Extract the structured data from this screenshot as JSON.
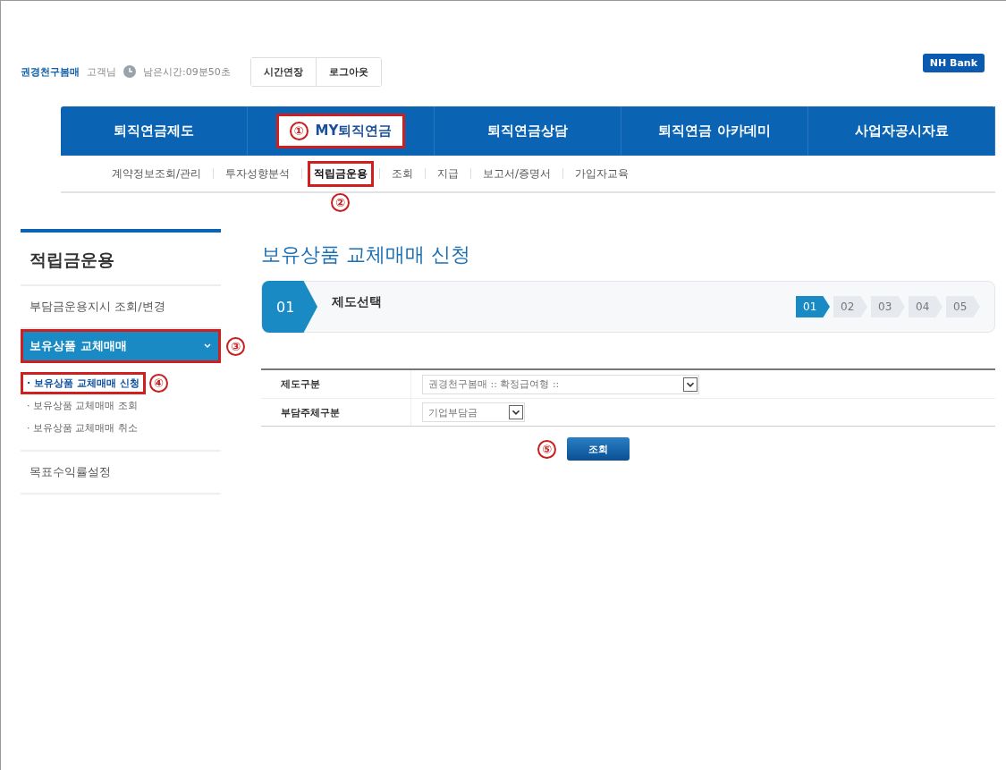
{
  "header": {
    "user_name": "권경천구봄매",
    "user_suffix": "고객님",
    "remaining_time": "남은시간:09분50초",
    "buttons": [
      "시간연장",
      "로그아웃"
    ],
    "brand": "NH Bank"
  },
  "main_nav": [
    {
      "label": "퇴직연금제도",
      "selected": false
    },
    {
      "label": "MY퇴직연금",
      "selected": true,
      "callout": "①"
    },
    {
      "label": "퇴직연금상담",
      "selected": false
    },
    {
      "label": "퇴직연금 아카데미",
      "selected": false
    },
    {
      "label": "사업자공시자료",
      "selected": false
    }
  ],
  "sub_nav": [
    {
      "label": "계약정보조회/관리",
      "selected": false
    },
    {
      "label": "투자성향분석",
      "selected": false
    },
    {
      "label": "적립금운용",
      "selected": true,
      "callout": "②"
    },
    {
      "label": "조회",
      "selected": false
    },
    {
      "label": "지급",
      "selected": false
    },
    {
      "label": "보고서/증명서",
      "selected": false
    },
    {
      "label": "가입자교육",
      "selected": false
    }
  ],
  "sidebar": {
    "title": "적립금운용",
    "items": [
      {
        "label": "부담금운용지시 조회/변경",
        "selected": false
      },
      {
        "label": "보유상품 교체매매",
        "selected": true,
        "expanded": true,
        "callout": "③",
        "children": [
          {
            "label": "· 보유상품 교체매매 신청",
            "selected": true,
            "callout": "④"
          },
          {
            "label": "· 보유상품 교체매매 조회",
            "selected": false
          },
          {
            "label": "· 보유상품 교체매매 취소",
            "selected": false
          }
        ]
      },
      {
        "label": "목표수익률설정",
        "selected": false
      }
    ]
  },
  "page_title": "보유상품 교체매매 신청",
  "step_bar": {
    "number": "01",
    "label": "제도선택",
    "steps": [
      {
        "label": "01",
        "selected": true
      },
      {
        "label": "02",
        "selected": false
      },
      {
        "label": "03",
        "selected": false
      },
      {
        "label": "04",
        "selected": false
      },
      {
        "label": "05",
        "selected": false
      }
    ]
  },
  "form": [
    {
      "label": "제도구분",
      "value": "권경천구봄매 :: 확정급여형 ::"
    },
    {
      "label": "부담주체구분",
      "value": "기업부담금"
    }
  ],
  "submit": {
    "label": "조회",
    "callout": "⑤"
  }
}
